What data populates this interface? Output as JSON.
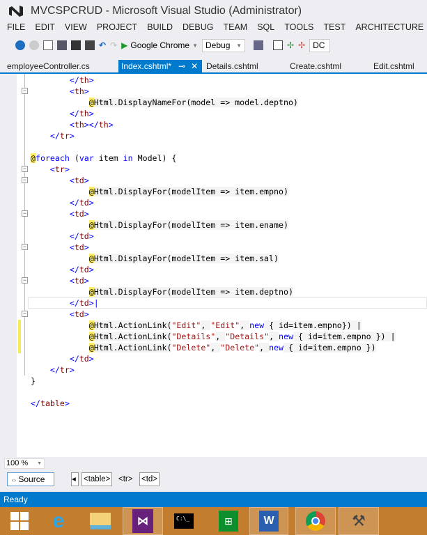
{
  "window": {
    "title": "MVCSPCRUD - Microsoft Visual Studio (Administrator)"
  },
  "menu": [
    "FILE",
    "EDIT",
    "VIEW",
    "PROJECT",
    "BUILD",
    "DEBUG",
    "TEAM",
    "SQL",
    "TOOLS",
    "TEST",
    "ARCHITECTURE"
  ],
  "toolbar": {
    "run_target": "Google Chrome",
    "configuration": "Debug",
    "cut_off": "DC"
  },
  "tabs": [
    {
      "label": "employeeController.cs"
    },
    {
      "label": "Index.cshtml*",
      "active": true
    },
    {
      "label": "Details.cshtml"
    },
    {
      "label": "Create.cshtml"
    },
    {
      "label": "Edit.cshtml"
    }
  ],
  "code": [
    [
      [
        "tg",
        "        </"
      ],
      [
        "tn",
        "th"
      ],
      [
        "tg",
        ">"
      ]
    ],
    [
      [
        "tg",
        "        <"
      ],
      [
        "tn",
        "th"
      ],
      [
        "tg",
        ">"
      ]
    ],
    [
      [
        "",
        "            "
      ],
      [
        "at",
        "@"
      ],
      [
        "r",
        "Html.DisplayNameFor(model => model.deptno)"
      ]
    ],
    [
      [
        "tg",
        "        </"
      ],
      [
        "tn",
        "th"
      ],
      [
        "tg",
        ">"
      ]
    ],
    [
      [
        "tg",
        "        <"
      ],
      [
        "tn",
        "th"
      ],
      [
        "tg",
        "></"
      ],
      [
        "tn",
        "th"
      ],
      [
        "tg",
        ">"
      ]
    ],
    [
      [
        "tg",
        "    </"
      ],
      [
        "tn",
        "tr"
      ],
      [
        "tg",
        ">"
      ]
    ],
    [],
    [
      [
        "at",
        "@"
      ],
      [
        "kw",
        "foreach"
      ],
      [
        "r",
        " ("
      ],
      [
        "kw",
        "var"
      ],
      [
        "r",
        " item "
      ],
      [
        "kw",
        "in"
      ],
      [
        "r",
        " Model) {"
      ]
    ],
    [
      [
        "tg",
        "    <"
      ],
      [
        "tn",
        "tr"
      ],
      [
        "tg",
        ">"
      ]
    ],
    [
      [
        "tg",
        "        <"
      ],
      [
        "tn",
        "td"
      ],
      [
        "tg",
        ">"
      ]
    ],
    [
      [
        "",
        "            "
      ],
      [
        "at",
        "@"
      ],
      [
        "r",
        "Html.DisplayFor(modelItem => item.empno)"
      ]
    ],
    [
      [
        "tg",
        "        </"
      ],
      [
        "tn",
        "td"
      ],
      [
        "tg",
        ">"
      ]
    ],
    [
      [
        "tg",
        "        <"
      ],
      [
        "tn",
        "td"
      ],
      [
        "tg",
        ">"
      ]
    ],
    [
      [
        "",
        "            "
      ],
      [
        "at",
        "@"
      ],
      [
        "r",
        "Html.DisplayFor(modelItem => item.ename)"
      ]
    ],
    [
      [
        "tg",
        "        </"
      ],
      [
        "tn",
        "td"
      ],
      [
        "tg",
        ">"
      ]
    ],
    [
      [
        "tg",
        "        <"
      ],
      [
        "tn",
        "td"
      ],
      [
        "tg",
        ">"
      ]
    ],
    [
      [
        "",
        "            "
      ],
      [
        "at",
        "@"
      ],
      [
        "r",
        "Html.DisplayFor(modelItem => item.sal)"
      ]
    ],
    [
      [
        "tg",
        "        </"
      ],
      [
        "tn",
        "td"
      ],
      [
        "tg",
        ">"
      ]
    ],
    [
      [
        "tg",
        "        <"
      ],
      [
        "tn",
        "td"
      ],
      [
        "tg",
        ">"
      ]
    ],
    [
      [
        "",
        "            "
      ],
      [
        "at",
        "@"
      ],
      [
        "r",
        "Html.DisplayFor(modelItem => item.deptno)"
      ]
    ],
    [
      [
        "tg",
        "        </"
      ],
      [
        "tn",
        "td"
      ],
      [
        "tg",
        ">|"
      ]
    ],
    [
      [
        "tg",
        "        <"
      ],
      [
        "tn",
        "td"
      ],
      [
        "tg",
        ">"
      ]
    ],
    [
      [
        "",
        "            "
      ],
      [
        "at",
        "@"
      ],
      [
        "r",
        "Html.ActionLink("
      ],
      [
        "st",
        "\"Edit\""
      ],
      [
        "r",
        ", "
      ],
      [
        "st",
        "\"Edit\""
      ],
      [
        "r",
        ", "
      ],
      [
        "kw",
        "new"
      ],
      [
        "r",
        " { id=item.empno}) |"
      ]
    ],
    [
      [
        "",
        "            "
      ],
      [
        "at",
        "@"
      ],
      [
        "r",
        "Html.ActionLink("
      ],
      [
        "st",
        "\"Details\""
      ],
      [
        "r",
        ", "
      ],
      [
        "st",
        "\"Details\""
      ],
      [
        "r",
        ", "
      ],
      [
        "kw",
        "new"
      ],
      [
        "r",
        " { id=item.empno }) |"
      ]
    ],
    [
      [
        "",
        "            "
      ],
      [
        "at",
        "@"
      ],
      [
        "r",
        "Html.ActionLink("
      ],
      [
        "st",
        "\"Delete\""
      ],
      [
        "r",
        ", "
      ],
      [
        "st",
        "\"Delete\""
      ],
      [
        "r",
        ", "
      ],
      [
        "kw",
        "new"
      ],
      [
        "r",
        " { id=item.empno })"
      ]
    ],
    [
      [
        "tg",
        "        </"
      ],
      [
        "tn",
        "td"
      ],
      [
        "tg",
        ">"
      ]
    ],
    [
      [
        "tg",
        "    </"
      ],
      [
        "tn",
        "tr"
      ],
      [
        "tg",
        ">"
      ]
    ],
    [
      [
        "r",
        "}"
      ]
    ],
    [],
    [
      [
        "tg",
        "</"
      ],
      [
        "tn",
        "table"
      ],
      [
        "tg",
        ">"
      ]
    ]
  ],
  "editor": {
    "zoom": "100 %"
  },
  "bottom": {
    "source_label": "Source",
    "breadcrumbs": [
      "<table>",
      "<tr>",
      "<td>"
    ]
  },
  "status": {
    "text": "Ready"
  },
  "colors": {
    "accent": "#007acc",
    "taskbar": "#c37d2e"
  }
}
